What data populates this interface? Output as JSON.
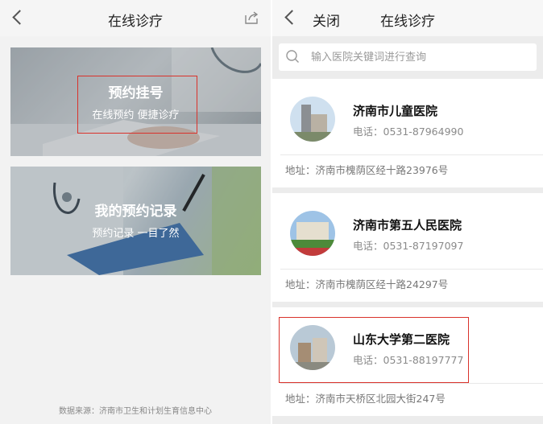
{
  "left": {
    "nav_title": "在线诊疗",
    "cards": [
      {
        "title": "预约挂号",
        "subtitle": "在线预约 便捷诊疗"
      },
      {
        "title": "我的预约记录",
        "subtitle": "预约记录 一目了然"
      }
    ],
    "footer": "数据来源：济南市卫生和计划生育信息中心"
  },
  "right": {
    "close_label": "关闭",
    "nav_title": "在线诊疗",
    "search_placeholder": "输入医院关键词进行查询",
    "hospitals": [
      {
        "name": "济南市儿童医院",
        "phone": "电话：0531-87964990",
        "address": "地址：济南市槐荫区经十路23976号"
      },
      {
        "name": "济南市第五人民医院",
        "phone": "电话：0531-87197097",
        "address": "地址：济南市槐荫区经十路24297号"
      },
      {
        "name": "山东大学第二医院",
        "phone": "电话：0531-88197777",
        "address": "地址：济南市天桥区北园大街247号"
      }
    ]
  },
  "colors": {
    "highlight": "#d9322b"
  }
}
